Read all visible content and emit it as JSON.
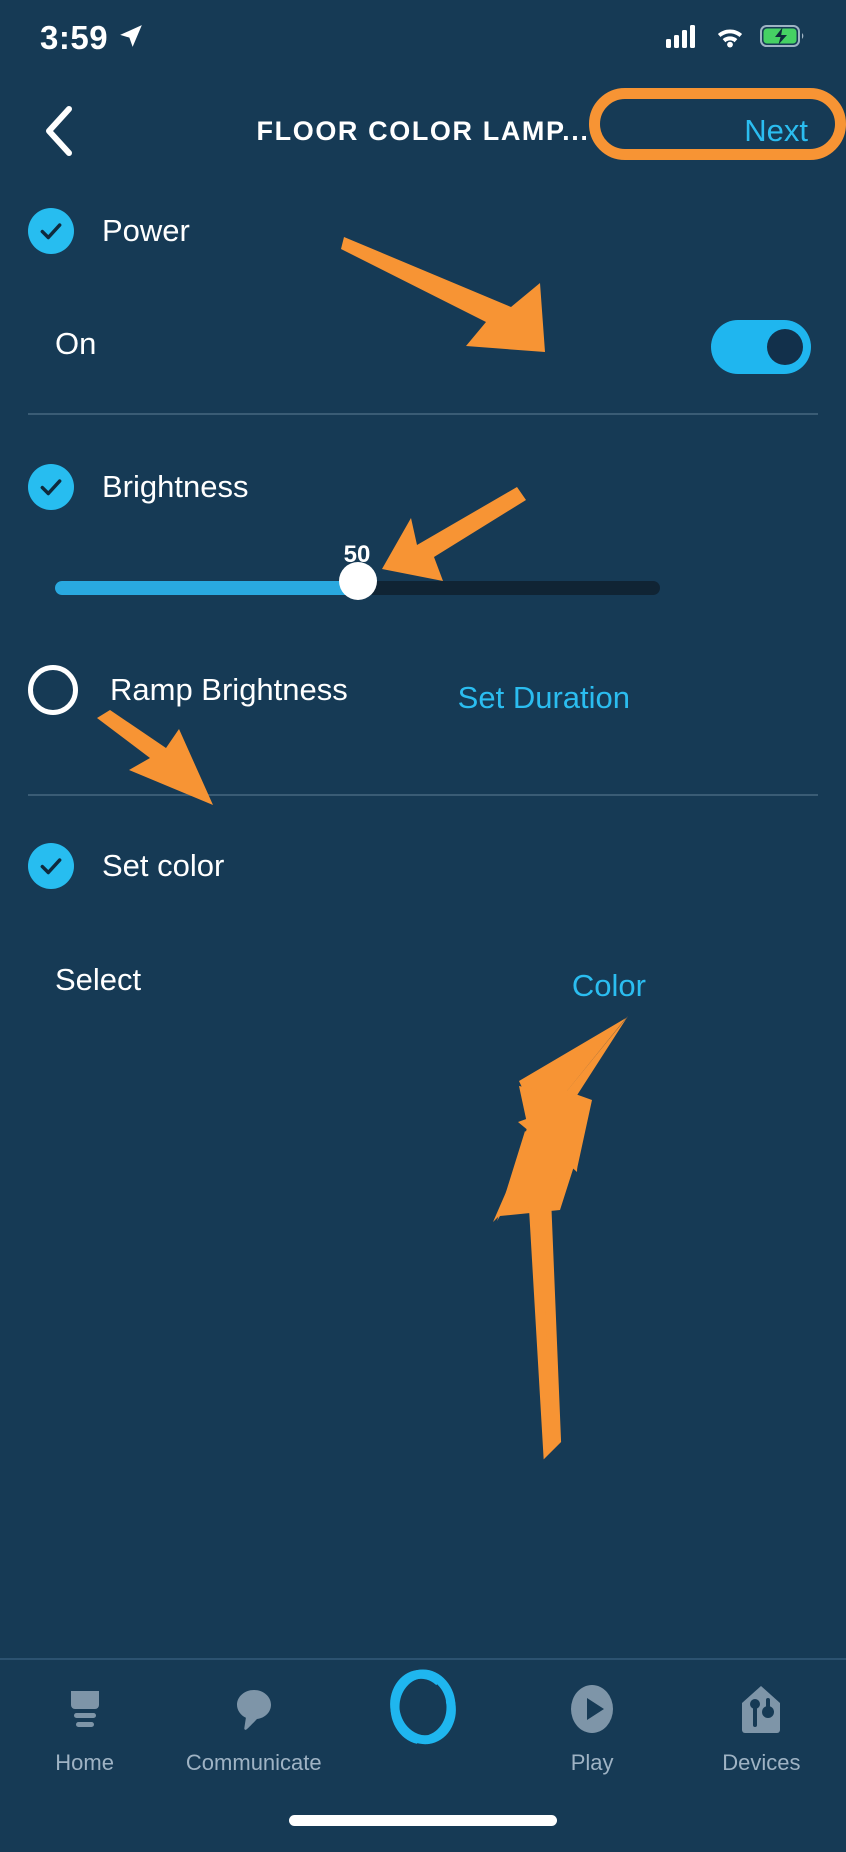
{
  "theme": {
    "background": "#163a55",
    "accent_cyan": "#2bbdf0",
    "highlight_orange": "#f79434",
    "text_primary": "#ffffff",
    "text_muted": "#9fb3c4",
    "divider": "#3a5c75"
  },
  "status_bar": {
    "time": "3:59",
    "location_icon": "location-arrow-icon",
    "cellular_icon": "cellular-signal-icon",
    "wifi_icon": "wifi-icon",
    "battery_icon": "battery-charging-icon",
    "battery_state": "charging"
  },
  "header": {
    "back_icon": "back-chevron-icon",
    "title": "FLOOR COLOR LAMP...",
    "next_label": "Next",
    "next_highlighted": true
  },
  "sections": {
    "power": {
      "label": "Power",
      "checked": true,
      "state_label": "On",
      "toggle_on": true
    },
    "brightness": {
      "label": "Brightness",
      "checked": true,
      "slider": {
        "value": "50",
        "min": 0,
        "max": 100,
        "percent": 50
      },
      "ramp": {
        "label": "Ramp Brightness",
        "checked": false,
        "action_label": "Set Duration"
      }
    },
    "set_color": {
      "label": "Set color",
      "checked": true,
      "select_label": "Select",
      "value_label": "Color"
    }
  },
  "annotations": {
    "arrow_to_toggle": "orange-arrow",
    "arrow_to_slider": "orange-arrow",
    "arrow_to_ramp_checkbox": "orange-arrow",
    "arrow_to_color": "orange-arrow",
    "next_button_ring": "orange-ring"
  },
  "tabbar": {
    "items": [
      {
        "label": "Home",
        "icon": "home-icon",
        "active": false
      },
      {
        "label": "Communicate",
        "icon": "speech-bubble-icon",
        "active": false
      },
      {
        "label": "",
        "icon": "alexa-ring-icon",
        "active": true
      },
      {
        "label": "Play",
        "icon": "play-circle-icon",
        "active": false
      },
      {
        "label": "Devices",
        "icon": "devices-icon",
        "active": false
      }
    ]
  }
}
